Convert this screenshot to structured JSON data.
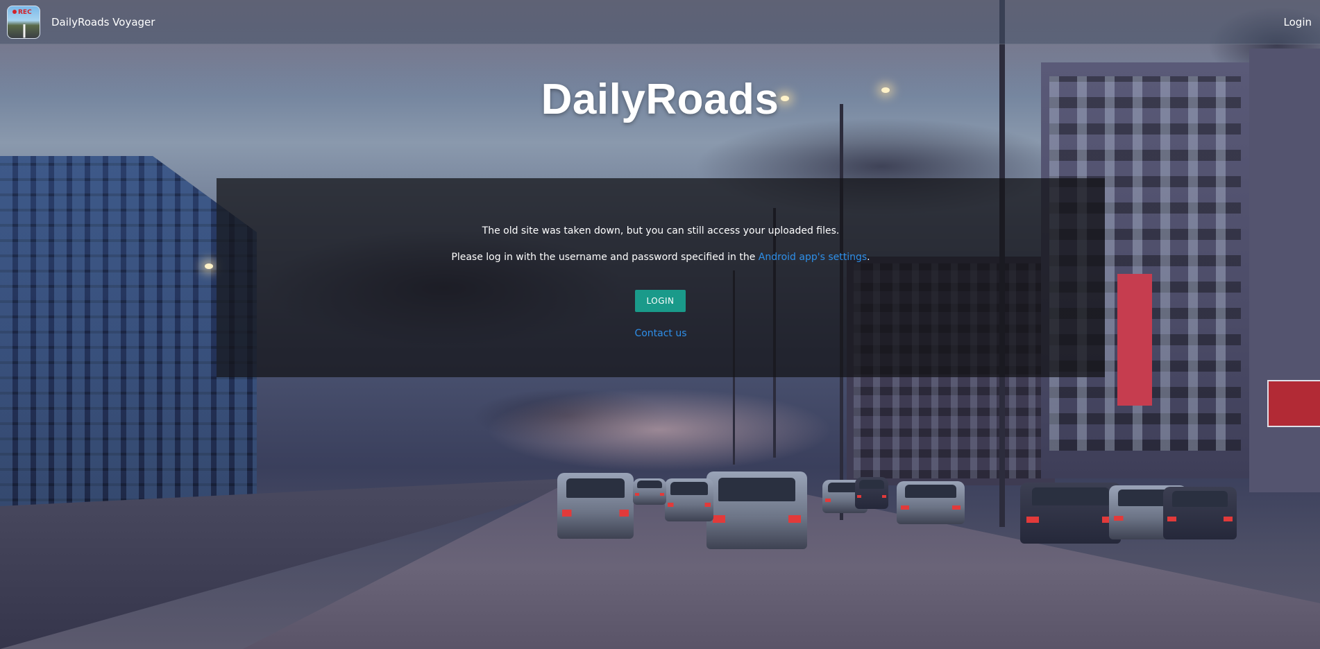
{
  "navbar": {
    "app_logo": {
      "icon": "dashcam-app-icon",
      "badge_text": "REC"
    },
    "brand_name": "DailyRoads Voyager",
    "login_link": "Login"
  },
  "hero": {
    "title": "DailyRoads"
  },
  "panel": {
    "message_line_1": "The old site was taken down, but you can still access your uploaded files.",
    "message_line_2_prefix": "Please log in with the username and password specified in the ",
    "message_line_2_link": "Android app's settings",
    "message_line_2_suffix": ".",
    "login_button": "LOGIN",
    "contact_link": "Contact us"
  },
  "colors": {
    "accent_button": "#1a9a8a",
    "link": "#2e8fe8",
    "navbar_bg": "rgba(70,82,104,0.55)",
    "panel_bg": "rgba(20,20,24,0.74)"
  }
}
